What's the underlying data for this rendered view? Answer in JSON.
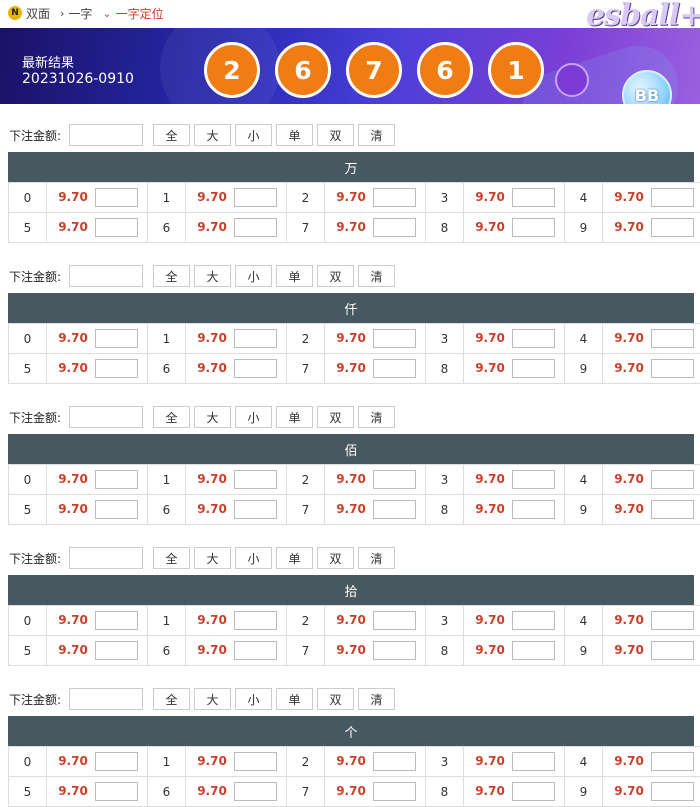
{
  "nav": {
    "badge": "N",
    "items": [
      {
        "label": "双面"
      },
      {
        "label": "一字"
      },
      {
        "label": "一字定位"
      }
    ]
  },
  "banner": {
    "title": "最新结果",
    "issue": "20231026-0910",
    "balls": [
      "2",
      "6",
      "7",
      "6",
      "1"
    ],
    "logo": "esball+",
    "bb_label": "BB"
  },
  "controls": {
    "amount_label": "下注金额:",
    "buttons": [
      "全",
      "大",
      "小",
      "单",
      "双",
      "清"
    ]
  },
  "sections": [
    {
      "title": "万",
      "rows": [
        [
          {
            "n": "0",
            "o": "9.70"
          },
          {
            "n": "1",
            "o": "9.70"
          },
          {
            "n": "2",
            "o": "9.70"
          },
          {
            "n": "3",
            "o": "9.70"
          },
          {
            "n": "4",
            "o": "9.70"
          }
        ],
        [
          {
            "n": "5",
            "o": "9.70"
          },
          {
            "n": "6",
            "o": "9.70"
          },
          {
            "n": "7",
            "o": "9.70"
          },
          {
            "n": "8",
            "o": "9.70"
          },
          {
            "n": "9",
            "o": "9.70"
          }
        ]
      ]
    },
    {
      "title": "仟",
      "rows": [
        [
          {
            "n": "0",
            "o": "9.70"
          },
          {
            "n": "1",
            "o": "9.70"
          },
          {
            "n": "2",
            "o": "9.70"
          },
          {
            "n": "3",
            "o": "9.70"
          },
          {
            "n": "4",
            "o": "9.70"
          }
        ],
        [
          {
            "n": "5",
            "o": "9.70"
          },
          {
            "n": "6",
            "o": "9.70"
          },
          {
            "n": "7",
            "o": "9.70"
          },
          {
            "n": "8",
            "o": "9.70"
          },
          {
            "n": "9",
            "o": "9.70"
          }
        ]
      ]
    },
    {
      "title": "佰",
      "rows": [
        [
          {
            "n": "0",
            "o": "9.70"
          },
          {
            "n": "1",
            "o": "9.70"
          },
          {
            "n": "2",
            "o": "9.70"
          },
          {
            "n": "3",
            "o": "9.70"
          },
          {
            "n": "4",
            "o": "9.70"
          }
        ],
        [
          {
            "n": "5",
            "o": "9.70"
          },
          {
            "n": "6",
            "o": "9.70"
          },
          {
            "n": "7",
            "o": "9.70"
          },
          {
            "n": "8",
            "o": "9.70"
          },
          {
            "n": "9",
            "o": "9.70"
          }
        ]
      ]
    },
    {
      "title": "拾",
      "rows": [
        [
          {
            "n": "0",
            "o": "9.70"
          },
          {
            "n": "1",
            "o": "9.70"
          },
          {
            "n": "2",
            "o": "9.70"
          },
          {
            "n": "3",
            "o": "9.70"
          },
          {
            "n": "4",
            "o": "9.70"
          }
        ],
        [
          {
            "n": "5",
            "o": "9.70"
          },
          {
            "n": "6",
            "o": "9.70"
          },
          {
            "n": "7",
            "o": "9.70"
          },
          {
            "n": "8",
            "o": "9.70"
          },
          {
            "n": "9",
            "o": "9.70"
          }
        ]
      ]
    },
    {
      "title": "个",
      "rows": [
        [
          {
            "n": "0",
            "o": "9.70"
          },
          {
            "n": "1",
            "o": "9.70"
          },
          {
            "n": "2",
            "o": "9.70"
          },
          {
            "n": "3",
            "o": "9.70"
          },
          {
            "n": "4",
            "o": "9.70"
          }
        ],
        [
          {
            "n": "5",
            "o": "9.70"
          },
          {
            "n": "6",
            "o": "9.70"
          },
          {
            "n": "7",
            "o": "9.70"
          },
          {
            "n": "8",
            "o": "9.70"
          },
          {
            "n": "9",
            "o": "9.70"
          }
        ]
      ]
    }
  ],
  "colors": {
    "accent": "#d23a2a",
    "odds": "#c8412a",
    "header_bg": "#475860",
    "ball": "#f07d14"
  }
}
